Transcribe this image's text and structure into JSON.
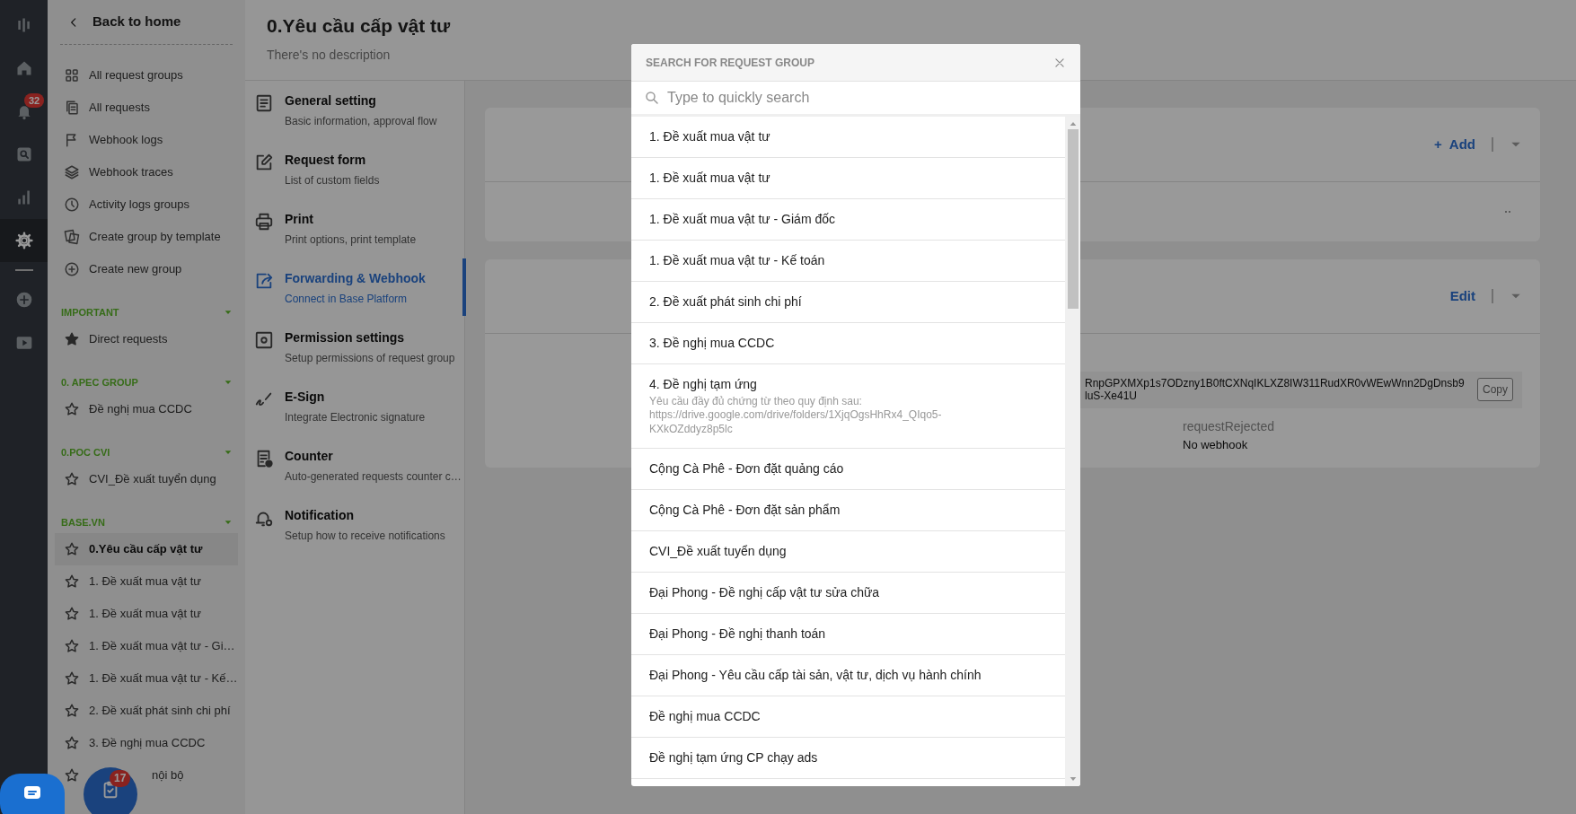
{
  "rail": {
    "items": [
      {
        "selected": false
      },
      {
        "selected": false
      },
      {
        "selected": false,
        "badge": "32"
      },
      {
        "selected": false
      },
      {
        "selected": false
      },
      {
        "selected": true
      },
      {
        "selected": false
      },
      {
        "selected": false
      }
    ]
  },
  "sidebar": {
    "back": "Back to home",
    "links": [
      "All request groups",
      "All requests",
      "Webhook logs",
      "Webhook traces",
      "Activity logs groups",
      "Create group by template",
      "Create new group"
    ],
    "sections": [
      {
        "title": "IMPORTANT",
        "items": [
          {
            "kind": "group",
            "label": "Direct requests",
            "starred": true,
            "selected": false
          }
        ]
      },
      {
        "title": "0. APEC GROUP",
        "items": [
          {
            "kind": "group",
            "label": "Đề nghị mua CCDC",
            "starred": false,
            "selected": false
          }
        ]
      },
      {
        "title": "0.POC CVI",
        "items": [
          {
            "kind": "group",
            "label": "CVI_Đề xuất tuyển dụng",
            "starred": false,
            "selected": false
          }
        ]
      },
      {
        "title": "BASE.VN",
        "items": [
          {
            "kind": "group",
            "label": "0.Yêu cầu cấp vật tư",
            "starred": false,
            "selected": true
          },
          {
            "kind": "group",
            "label": "1. Đề xuất mua vật tư",
            "starred": false,
            "selected": false
          },
          {
            "kind": "group",
            "label": "1. Đề xuất mua vật tư",
            "starred": false,
            "selected": false
          },
          {
            "kind": "group",
            "label": "1. Đề xuất mua vật tư - Gi…",
            "starred": false,
            "selected": false
          },
          {
            "kind": "group",
            "label": "1. Đề xuất mua vật tư - Kế…",
            "starred": false,
            "selected": false
          },
          {
            "kind": "group",
            "label": "2. Đề xuất phát sinh chi phí",
            "starred": false,
            "selected": false
          },
          {
            "kind": "group",
            "label": "3. Đề nghị mua CCDC",
            "starred": false,
            "selected": false
          },
          {
            "kind": "covered",
            "label": "nội bộ",
            "starred": false,
            "selected": false
          }
        ]
      }
    ]
  },
  "header": {
    "title": "0.Yêu cầu cấp vật tư",
    "description": "There's no description"
  },
  "settings_nav": [
    {
      "title": "General setting",
      "subtitle": "Basic information, approval flow",
      "selected": false
    },
    {
      "title": "Request form",
      "subtitle": "List of custom fields",
      "selected": false
    },
    {
      "title": "Print",
      "subtitle": "Print options, print template",
      "selected": false
    },
    {
      "title": "Forwarding & Webhook",
      "subtitle": "Connect in Base Platform",
      "selected": true
    },
    {
      "title": "Permission settings",
      "subtitle": "Setup permissions of request group",
      "selected": false
    },
    {
      "title": "E-Sign",
      "subtitle": "Integrate Electronic signature",
      "selected": false
    },
    {
      "title": "Counter",
      "subtitle": "Auto-generated requests counter c…",
      "selected": false
    },
    {
      "title": "Notification",
      "subtitle": "Setup how to receive notifications",
      "selected": false
    }
  ],
  "cards": [
    {
      "action": "+",
      "action_label": "Add"
    },
    {
      "action_label": "Edit",
      "token_lines": [
        "RnpGPXMXp1s7ODzny1B0ftCXNqIKLXZ8IW311RudXR0vWEwWnn2DgDnsb9",
        "luS-Xe41U"
      ],
      "copy": "Copy",
      "event": "requestRejected",
      "webhook": "No webhook"
    }
  ],
  "modal": {
    "title": "SEARCH FOR REQUEST GROUP",
    "placeholder": "Type to quickly search",
    "items": [
      {
        "label": "1. Đề xuất mua vật tư"
      },
      {
        "label": "1. Đề xuất mua vật tư"
      },
      {
        "label": "1. Đề xuất mua vật tư - Giám đốc"
      },
      {
        "label": "1. Đề xuất mua vật tư - Kế toán"
      },
      {
        "label": "2. Đề xuất phát sinh chi phí"
      },
      {
        "label": "3. Đề nghị mua CCDC"
      },
      {
        "label": "4. Đề nghị tạm ứng",
        "description": "Yêu cầu đầy đủ chứng từ theo quy định sau: https://drive.google.com/drive/folders/1XjqOgsHhRx4_QIqo5-KXkOZddyz8p5lc"
      },
      {
        "label": "Cộng Cà Phê - Đơn đặt quảng cáo"
      },
      {
        "label": "Cộng Cà Phê - Đơn đặt sản phẩm"
      },
      {
        "label": "CVI_Đề xuất tuyển dụng"
      },
      {
        "label": "Đại Phong - Đề nghị cấp vật tư sửa chữa"
      },
      {
        "label": "Đại Phong - Đề nghị thanh toán"
      },
      {
        "label": "Đại Phong - Yêu cầu cấp tài sản, vật tư, dịch vụ hành chính"
      },
      {
        "label": "Đề nghị mua CCDC"
      },
      {
        "label": "Đề nghị tạm ứng CP chạy ads"
      }
    ]
  },
  "floating": {
    "tasks_badge": "17"
  }
}
